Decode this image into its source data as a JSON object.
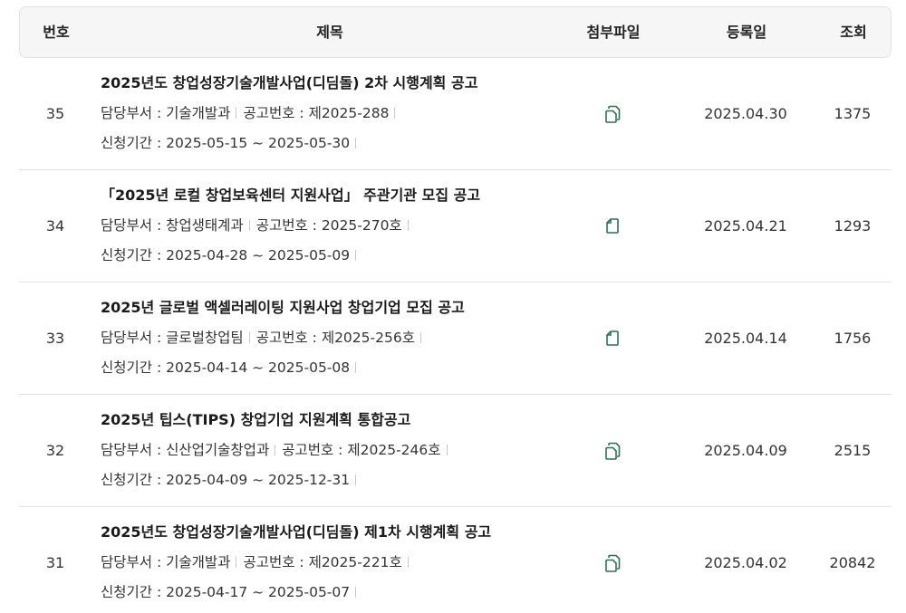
{
  "header": {
    "num": "번호",
    "title": "제목",
    "file": "첨부파일",
    "date": "등록일",
    "views": "조회"
  },
  "colors": {
    "icon": "#2e6f55",
    "border": "#e4e4e4",
    "header_bg": "#f6f6f6"
  },
  "rows": [
    {
      "num": "35",
      "title": "2025년도 창업성장기술개발사업(디딤돌) 2차 시행계획 공고",
      "dept_label": "담당부서 : ",
      "dept": "기술개발과",
      "notice_label": "공고번호 : ",
      "notice": "제2025-288",
      "period_label": "신청기간 : ",
      "period": "2025-05-15 ~ 2025-05-30",
      "icon": "file-multi-icon",
      "date": "2025.04.30",
      "views": "1375"
    },
    {
      "num": "34",
      "title": "「2025년 로컬 창업보육센터 지원사업」 주관기관 모집 공고",
      "dept_label": "담당부서 : ",
      "dept": "창업생태계과",
      "notice_label": "공고번호 : ",
      "notice": "2025-270호",
      "period_label": "신청기간 : ",
      "period": "2025-04-28 ~ 2025-05-09",
      "icon": "file-icon",
      "date": "2025.04.21",
      "views": "1293"
    },
    {
      "num": "33",
      "title": "2025년 글로벌 액셀러레이팅 지원사업 창업기업 모집 공고",
      "dept_label": "담당부서 : ",
      "dept": "글로벌창업팀",
      "notice_label": "공고번호 : ",
      "notice": "제2025-256호",
      "period_label": "신청기간 : ",
      "period": "2025-04-14 ~ 2025-05-08",
      "icon": "file-icon",
      "date": "2025.04.14",
      "views": "1756"
    },
    {
      "num": "32",
      "title": "2025년 팁스(TIPS) 창업기업 지원계획 통합공고",
      "dept_label": "담당부서 : ",
      "dept": "신산업기술창업과",
      "notice_label": "공고번호 : ",
      "notice": "제2025-246호",
      "period_label": "신청기간 : ",
      "period": "2025-04-09 ~ 2025-12-31",
      "icon": "file-multi-icon",
      "date": "2025.04.09",
      "views": "2515"
    },
    {
      "num": "31",
      "title": "2025년도 창업성장기술개발사업(디딤돌) 제1차 시행계획 공고",
      "dept_label": "담당부서 : ",
      "dept": "기술개발과",
      "notice_label": "공고번호 : ",
      "notice": "제2025-221호",
      "period_label": "신청기간 : ",
      "period": "2025-04-17 ~ 2025-05-07",
      "icon": "file-multi-icon",
      "date": "2025.04.02",
      "views": "20842"
    }
  ]
}
